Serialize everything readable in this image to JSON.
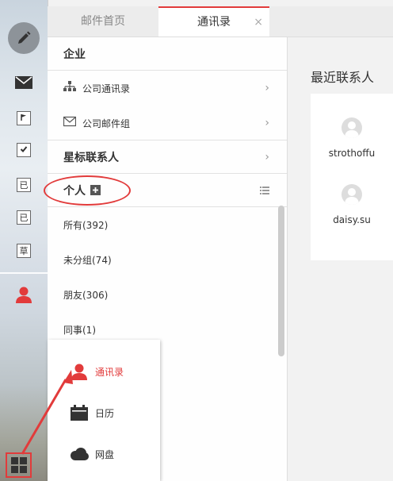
{
  "tabs": [
    {
      "label": "邮件首页",
      "active": false
    },
    {
      "label": "通讯录",
      "active": true,
      "close": "×"
    }
  ],
  "sidebar": {
    "items": [
      {
        "name": "compose-icon"
      },
      {
        "name": "mail-icon"
      },
      {
        "name": "flag-icon"
      },
      {
        "name": "check-icon"
      },
      {
        "name": "sent-icon",
        "label": "已"
      },
      {
        "name": "deleted-icon",
        "label": "已"
      },
      {
        "name": "draft-icon",
        "label": "草"
      },
      {
        "name": "contacts-icon"
      },
      {
        "name": "apps-grid-icon"
      }
    ]
  },
  "contacts_panel": {
    "enterprise": {
      "title": "企业",
      "items": [
        {
          "label": "公司通讯录",
          "icon": "org-chart-icon"
        },
        {
          "label": "公司邮件组",
          "icon": "group-mail-icon"
        }
      ]
    },
    "starred": {
      "title": "星标联系人"
    },
    "personal": {
      "title": "个人",
      "groups": [
        "所有(392)",
        "未分组(74)",
        "朋友(306)",
        "同事(1)"
      ]
    }
  },
  "recent": {
    "title": "最近联系人",
    "contacts": [
      "strothoffu",
      "daisy.su"
    ]
  },
  "apps_menu": {
    "items": [
      {
        "label": "通讯录",
        "icon": "person-icon",
        "active": true
      },
      {
        "label": "日历",
        "icon": "calendar-icon",
        "active": false
      },
      {
        "label": "网盘",
        "icon": "cloud-icon",
        "active": false
      }
    ]
  },
  "colors": {
    "accent": "#e23b3b",
    "icon_dark": "#333333"
  }
}
